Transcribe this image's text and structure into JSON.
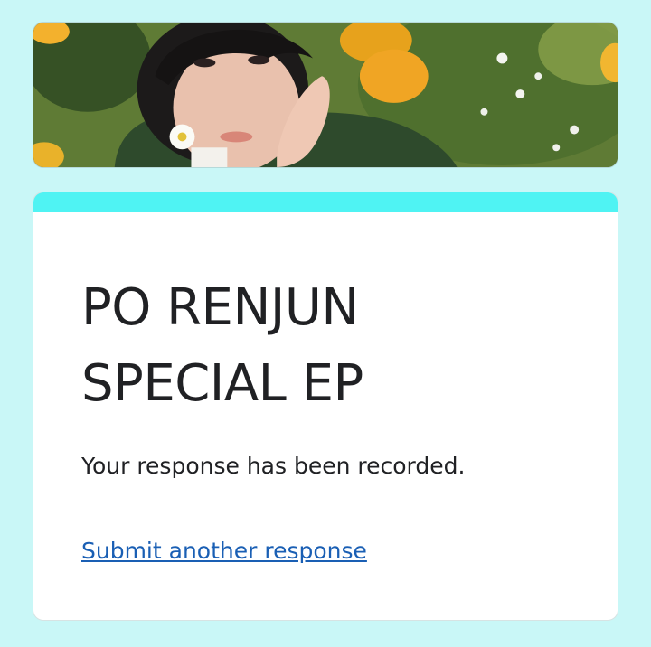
{
  "header": {
    "banner_image": "portrait-in-flower-field"
  },
  "form": {
    "title_line1": "PO RENJUN",
    "title_line2": "SPECIAL EP",
    "confirmation_message": "Your response has been recorded.",
    "submit_another_label": "Submit another response"
  },
  "colors": {
    "page_background": "#c9f7f7",
    "card_accent": "#4ff3f3",
    "card_background": "#ffffff",
    "link": "#1a5fb4",
    "text": "#202124"
  }
}
